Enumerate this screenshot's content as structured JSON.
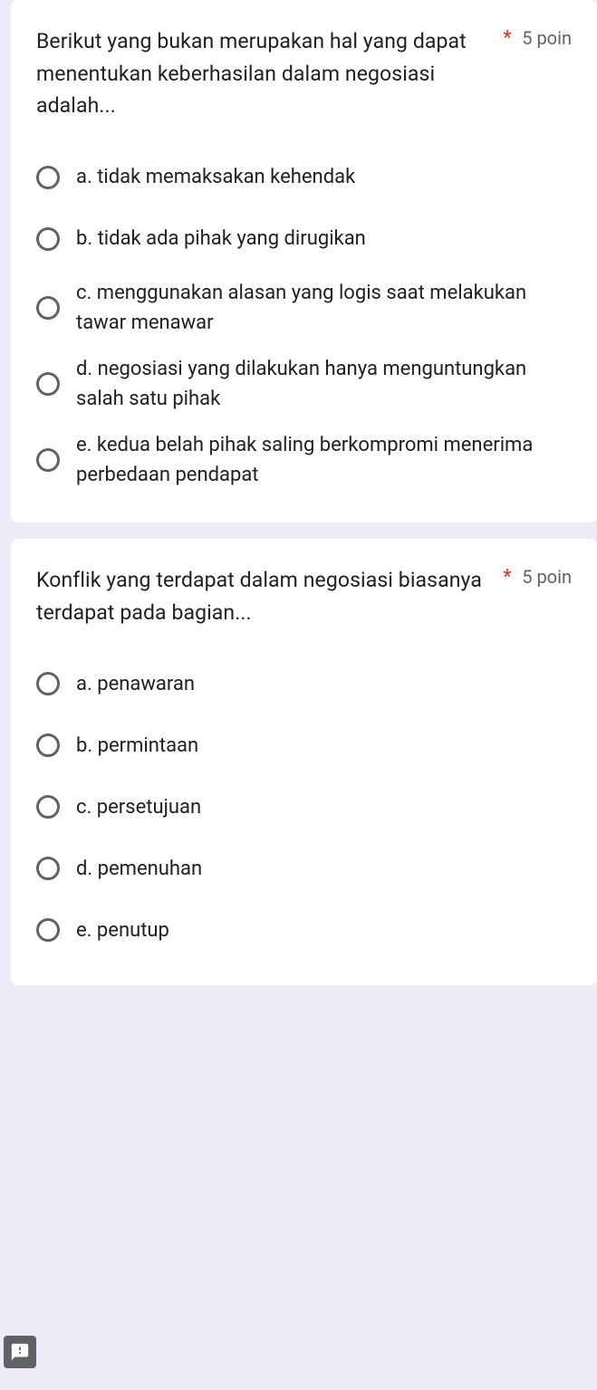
{
  "questions": [
    {
      "title": "Berikut yang bukan merupakan hal yang dapat menentukan keberhasilan dalam negosiasi adalah...",
      "required_mark": "*",
      "points": "5 poin",
      "options": [
        "a. tidak memaksakan kehendak",
        "b. tidak ada pihak yang dirugikan",
        "c. menggunakan alasan yang logis saat melakukan tawar menawar",
        "d. negosiasi yang dilakukan hanya menguntungkan salah satu pihak",
        "e. kedua belah pihak saling berkompromi menerima perbedaan pendapat"
      ]
    },
    {
      "title": "Konflik yang terdapat dalam negosiasi biasanya terdapat pada bagian...",
      "required_mark": "*",
      "points": "5 poin",
      "options": [
        "a. penawaran",
        "b. permintaan",
        "c. persetujuan",
        "d. pemenuhan",
        "e. penutup"
      ]
    }
  ]
}
